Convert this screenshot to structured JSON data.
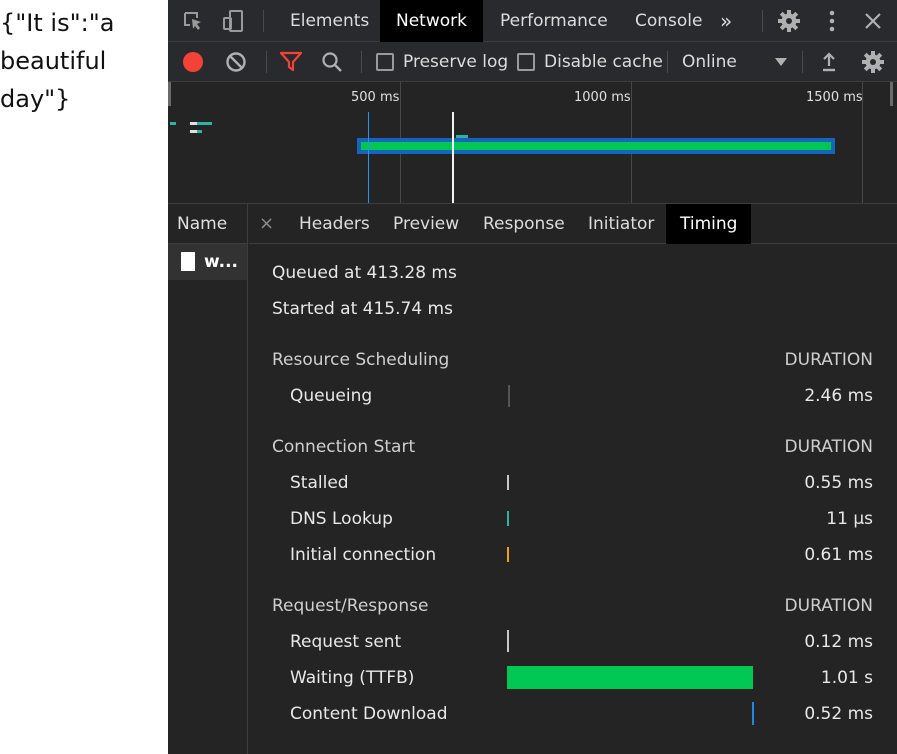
{
  "page": {
    "json_text": "{\"It is\":\"a beautiful day\"}"
  },
  "devtools": {
    "top_tabs": [
      {
        "label": "Elements"
      },
      {
        "label": "Network"
      },
      {
        "label": "Performance"
      },
      {
        "label": "Console"
      }
    ],
    "active_top_tab": "Network",
    "more_tabs": "»",
    "toolbar": {
      "preserve_log": "Preserve log",
      "disable_cache": "Disable cache",
      "throttle": "Online",
      "preserve_log_checked": false,
      "disable_cache_checked": false
    },
    "overview": {
      "ticks": [
        "500 ms",
        "1000 ms",
        "1500 ms"
      ]
    },
    "name_column": {
      "header": "Name",
      "row": "w..."
    },
    "detail_tabs": [
      {
        "label": "Headers"
      },
      {
        "label": "Preview"
      },
      {
        "label": "Response"
      },
      {
        "label": "Initiator"
      },
      {
        "label": "Timing"
      }
    ],
    "active_detail_tab": "Timing",
    "close_symbol": "×",
    "timing": {
      "queued_at": "Queued at 413.28 ms",
      "started_at": "Started at 415.74 ms",
      "duration_label": "DURATION",
      "sections": [
        {
          "title": "Resource Scheduling",
          "rows": [
            {
              "label": "Queueing",
              "value": "2.46 ms",
              "color": "#6e6e6e"
            }
          ]
        },
        {
          "title": "Connection Start",
          "rows": [
            {
              "label": "Stalled",
              "value": "0.55 ms",
              "color": "#c8c8c8"
            },
            {
              "label": "DNS Lookup",
              "value": "11 µs",
              "color": "#2cb3a3"
            },
            {
              "label": "Initial connection",
              "value": "0.61 ms",
              "color": "#f0a020"
            }
          ]
        },
        {
          "title": "Request/Response",
          "rows": [
            {
              "label": "Request sent",
              "value": "0.12 ms",
              "color": "#c8c8c8"
            },
            {
              "label": "Waiting (TTFB)",
              "value": "1.01 s",
              "color": "#00c853"
            },
            {
              "label": "Content Download",
              "value": "0.52 ms",
              "color": "#1e88e5"
            }
          ]
        }
      ]
    },
    "colors": {
      "record": "#f44336",
      "filter": "#f44336",
      "waterfall_bar": "#00c853",
      "waterfall_border": "#1565c0"
    }
  }
}
